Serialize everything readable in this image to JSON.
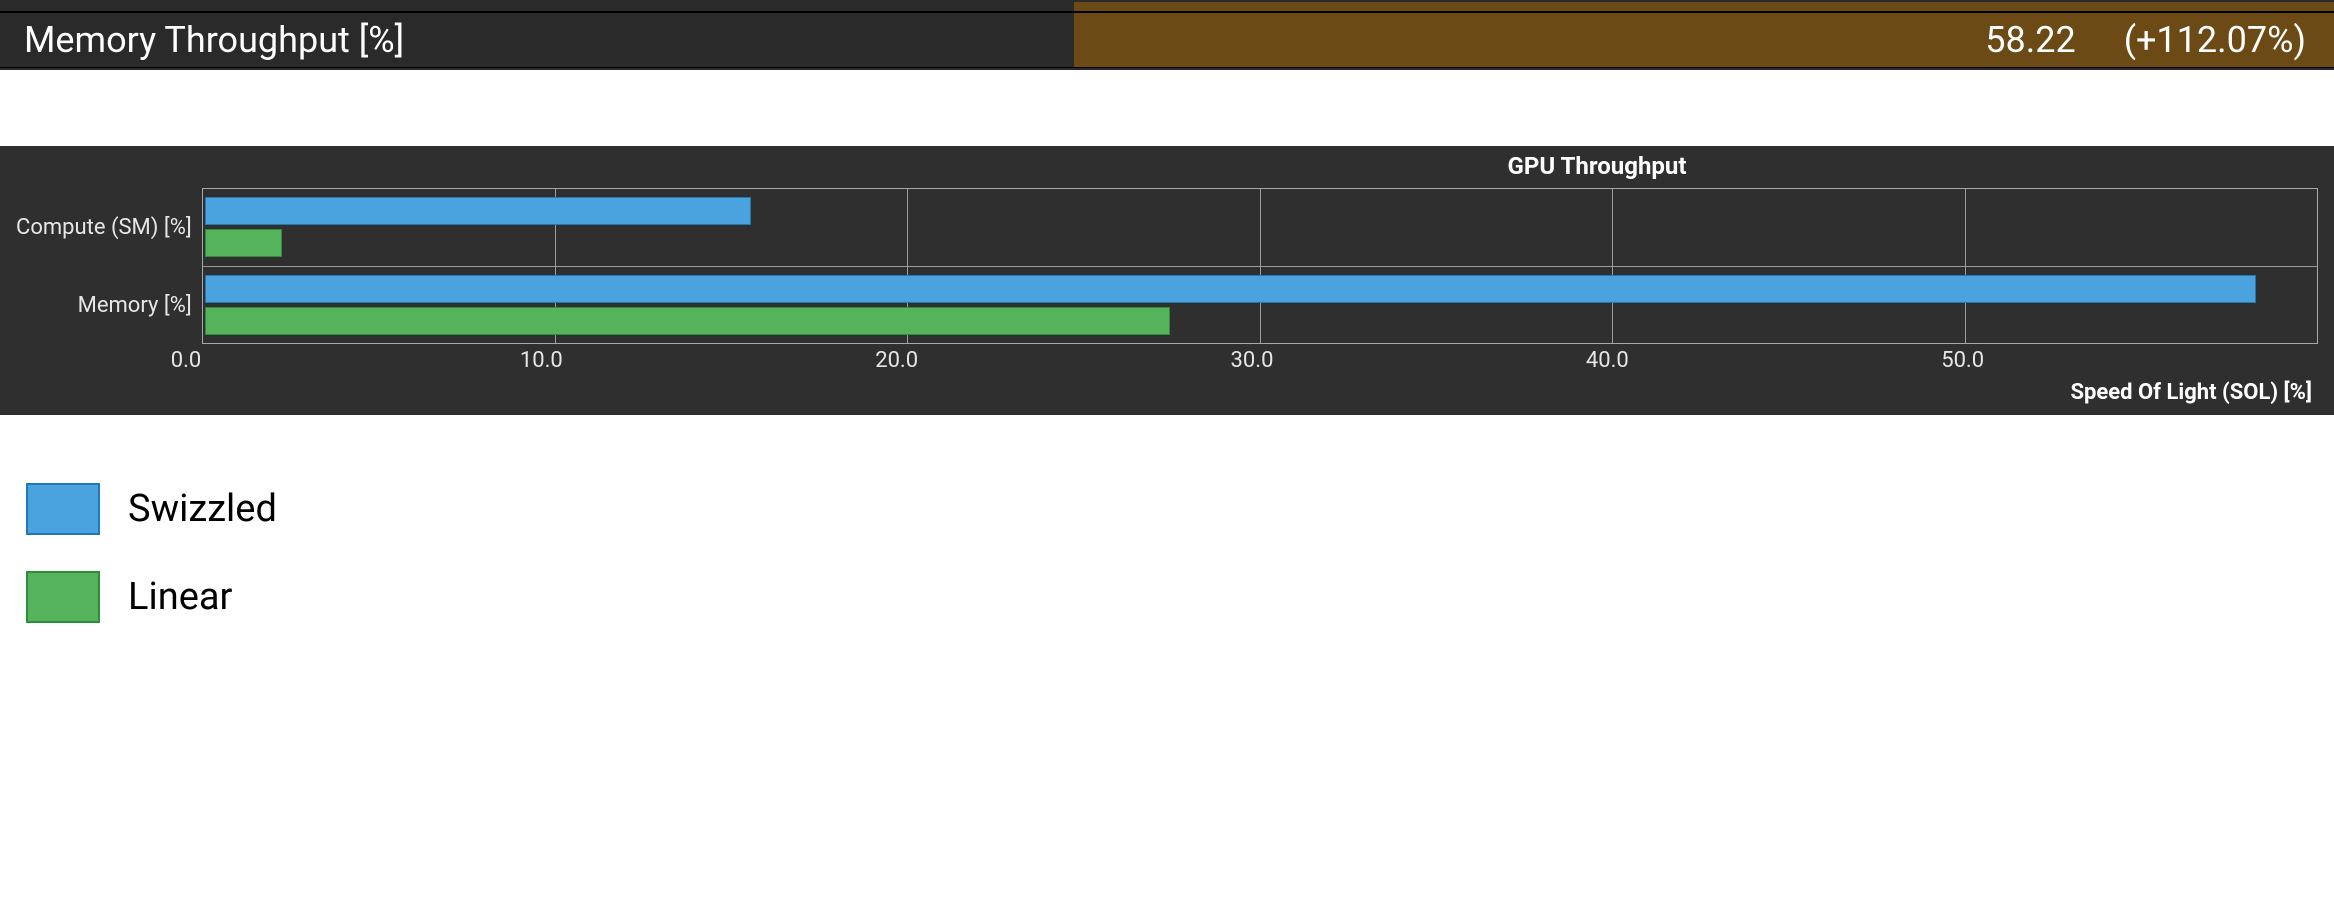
{
  "metrics": {
    "row_label": "Memory Throughput [%]",
    "value": "58.22",
    "delta": "(+112.07%)",
    "highlight_color": "#6b4a15"
  },
  "chart_data": {
    "type": "bar",
    "orientation": "horizontal",
    "title": "GPU Throughput",
    "xlabel": "Speed Of Light (SOL) [%]",
    "ylabel": "",
    "categories": [
      "Compute (SM) [%]",
      "Memory [%]"
    ],
    "series": [
      {
        "name": "Swizzled",
        "color": "#4aa3df",
        "values": [
          15.5,
          58.2
        ]
      },
      {
        "name": "Linear",
        "color": "#55b35c",
        "values": [
          2.2,
          27.4
        ]
      }
    ],
    "x_ticks": [
      0.0,
      10.0,
      20.0,
      30.0,
      40.0,
      50.0
    ],
    "xlim": [
      0,
      60
    ]
  },
  "x_tick_labels": {
    "t0": "0.0",
    "t1": "10.0",
    "t2": "20.0",
    "t3": "30.0",
    "t4": "40.0",
    "t5": "50.0"
  },
  "legend": {
    "items": [
      {
        "label": "Swizzled"
      },
      {
        "label": "Linear"
      }
    ]
  }
}
